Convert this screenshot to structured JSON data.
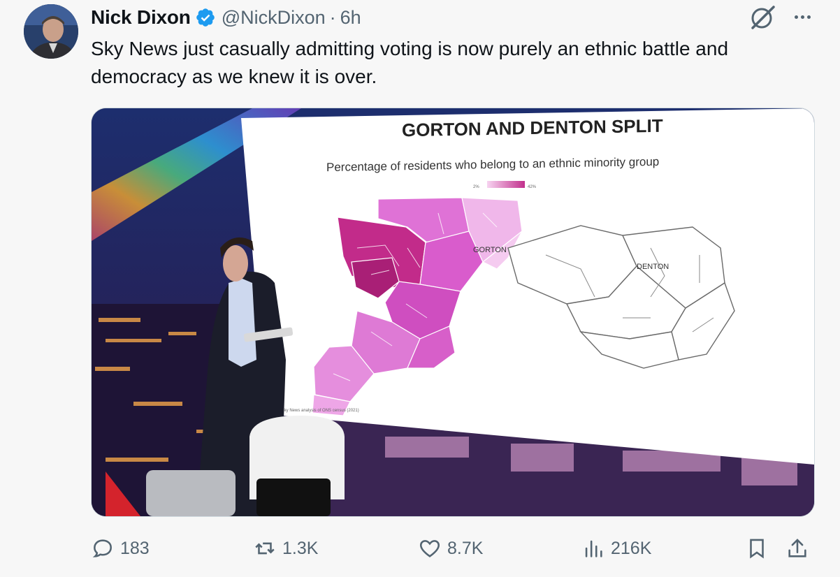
{
  "tweet": {
    "author_name": "Nick Dixon",
    "handle": "@NickDixon",
    "separator": "·",
    "time": "6h",
    "text": "Sky News just casually admitting voting is now purely an ethnic battle and democracy as we knew it is over."
  },
  "media": {
    "map_title": "GORTON AND DENTON SPLIT",
    "map_subtitle": "Percentage of residents who belong to an ethnic minority group",
    "legend_min": "2%",
    "legend_max": "42%",
    "label_gorton": "GORTON",
    "label_denton": "DENTON",
    "source": "CE: Sky News analysis of ONS census (2021)",
    "colors": {
      "high": "#b8247c",
      "mid": "#d94fbf",
      "low": "#f3c4ee",
      "none": "#ffffff"
    }
  },
  "actions": {
    "replies": "183",
    "reposts": "1.3K",
    "likes": "8.7K",
    "views": "216K"
  },
  "icons": {
    "reply": "reply-icon",
    "repost": "repost-icon",
    "like": "like-icon",
    "views": "views-icon",
    "bookmark": "bookmark-icon",
    "share": "share-icon",
    "grok": "grok-icon",
    "more": "more-icon",
    "verified": "verified-badge-icon"
  }
}
